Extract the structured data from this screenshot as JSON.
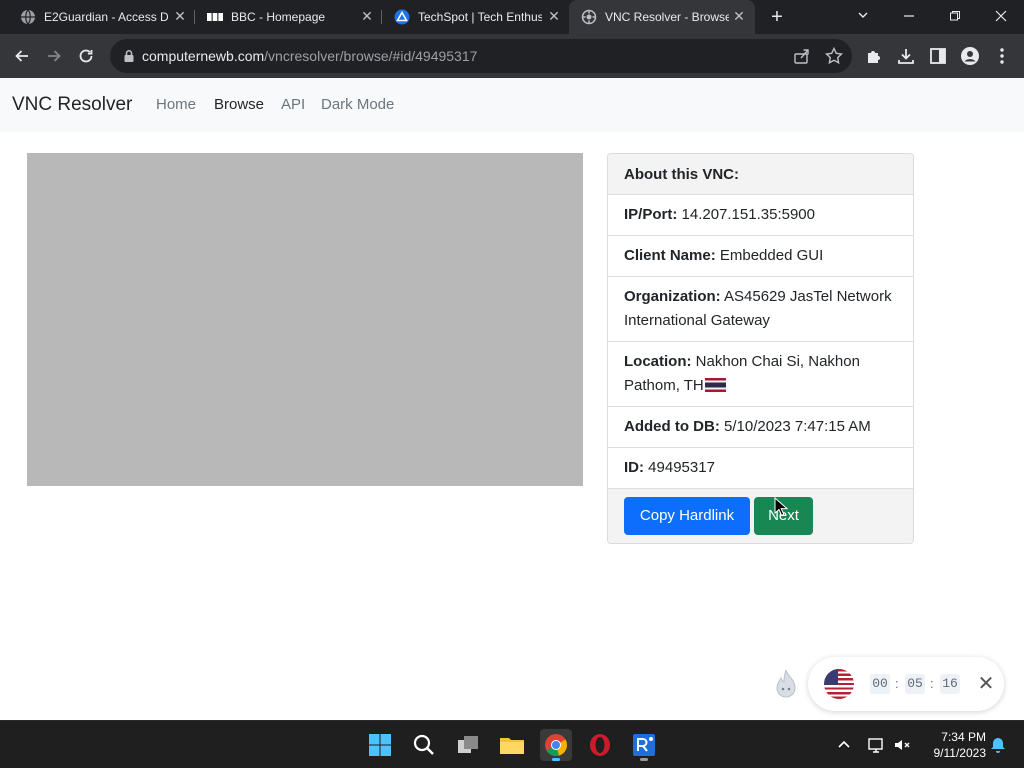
{
  "browser": {
    "tabs": [
      {
        "title": "E2Guardian - Access De",
        "active": false
      },
      {
        "title": "BBC - Homepage",
        "active": false
      },
      {
        "title": "TechSpot | Tech Enthus",
        "active": false
      },
      {
        "title": "VNC Resolver - Browse",
        "active": true
      }
    ],
    "url": {
      "host": "computernewb.com",
      "path": "/vncresolver/browse/#id/49495317"
    }
  },
  "site": {
    "brand": "VNC Resolver",
    "nav": [
      "Home",
      "Browse",
      "API",
      "Dark Mode"
    ],
    "active_nav": "Browse"
  },
  "card": {
    "header": "About this VNC:",
    "rows": [
      {
        "label": "IP/Port:",
        "value": "14.207.151.35:5900"
      },
      {
        "label": "Client Name:",
        "value": "Embedded GUI"
      },
      {
        "label": "Organization:",
        "value": "AS45629 JasTel Network International Gateway"
      },
      {
        "label": "Location:",
        "value": "Nakhon Chai Si, Nakhon Pathom, TH"
      },
      {
        "label": "Added to DB:",
        "value": "5/10/2023 7:47:15 AM"
      },
      {
        "label": "ID:",
        "value": "49495317"
      }
    ],
    "buttons": {
      "copy": "Copy Hardlink",
      "next": "Next"
    }
  },
  "vpn_widget": {
    "timer": {
      "h": "00",
      "m": "05",
      "s": "16",
      "sep": ":"
    }
  },
  "taskbar": {
    "time": "7:34 PM",
    "date": "9/11/2023"
  },
  "colors": {
    "primary_button": "#0d6efd",
    "success_button": "#198754",
    "preview_placeholder": "#b8b8b8"
  }
}
